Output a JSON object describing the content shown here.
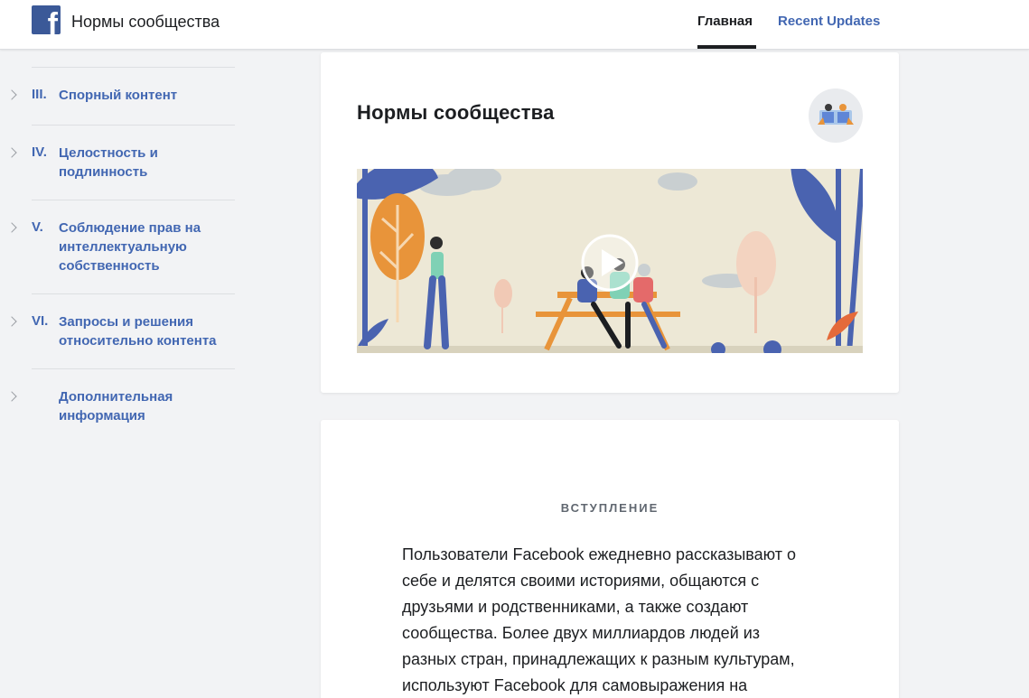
{
  "header": {
    "logo_glyph": "f",
    "site_title": "Нормы сообщества",
    "nav": {
      "home": "Главная",
      "updates": "Recent Updates"
    }
  },
  "sidebar": {
    "items": [
      {
        "num": "III.",
        "label": "Спорный контент"
      },
      {
        "num": "IV.",
        "label": "Целостность и подлинность"
      },
      {
        "num": "V.",
        "label": "Соблюдение прав на интеллектуальную собственность"
      },
      {
        "num": "VI.",
        "label": "Запросы и решения относительно контента"
      },
      {
        "num": "",
        "label": "Дополнительная информация"
      }
    ]
  },
  "main": {
    "card_title": "Нормы сообщества",
    "section_title": "ВСТУПЛЕНИЕ",
    "intro_text": "Пользователи Facebook ежедневно рассказывают о себе и делятся своими историями, общаются с друзьями и родственниками, а также создают сообщества. Более двух миллиардов людей из разных стран, принадлежащих к разным культурам, используют Facebook для самовыражения на"
  },
  "colors": {
    "brand": "#3b5998",
    "link": "#4267b2",
    "illustration_blue": "#4a63b0",
    "illustration_orange": "#e8943a"
  },
  "icons": [
    "facebook-logo-icon",
    "chevron-right-icon",
    "play-icon",
    "community-badge-icon"
  ]
}
